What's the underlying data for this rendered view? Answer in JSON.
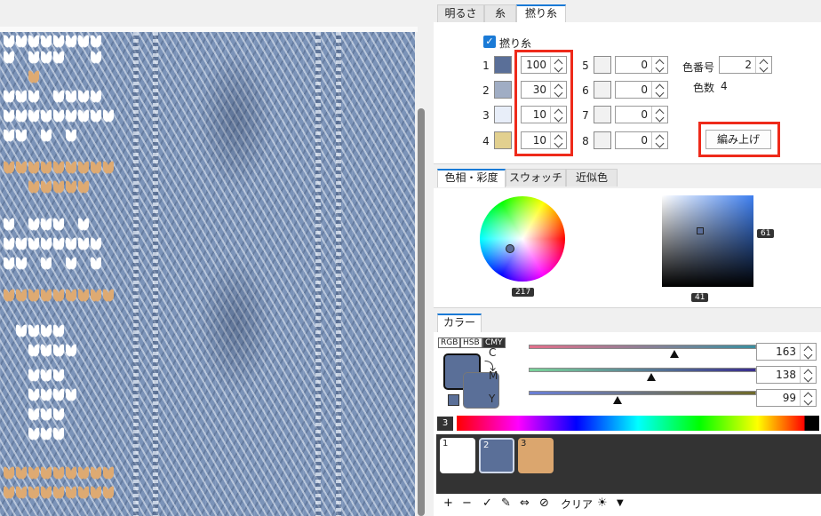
{
  "tabs_top": [
    {
      "label": "明るさ"
    },
    {
      "label": "糸"
    },
    {
      "label": "撚り糸"
    }
  ],
  "yarn": {
    "checkbox_label": "撚り糸",
    "rows_left": [
      {
        "num": "1",
        "color": "#5a6f98",
        "value": "100"
      },
      {
        "num": "2",
        "color": "#a0adc4",
        "value": "30"
      },
      {
        "num": "3",
        "color": "#e8eef9",
        "value": "10"
      },
      {
        "num": "4",
        "color": "#e2d08f",
        "value": "10"
      }
    ],
    "rows_right": [
      {
        "num": "5",
        "color": "#f1f1f1",
        "value": "0"
      },
      {
        "num": "6",
        "color": "#f1f1f1",
        "value": "0"
      },
      {
        "num": "7",
        "color": "#f1f1f1",
        "value": "0"
      },
      {
        "num": "8",
        "color": "#f1f1f1",
        "value": "0"
      }
    ],
    "color_number_label": "色番号",
    "color_number_value": "2",
    "color_count_label": "色数",
    "color_count_value": "4",
    "knit_button": "編み上げ"
  },
  "tabs_mid": [
    {
      "label": "色相・彩度"
    },
    {
      "label": "スウォッチ"
    },
    {
      "label": "近似色"
    }
  ],
  "picker": {
    "hue_value": "217",
    "saturation_value": "61",
    "brightness_value": "41"
  },
  "color_tab": {
    "label": "カラー"
  },
  "modes": [
    {
      "label": "RGB"
    },
    {
      "label": "HSB"
    },
    {
      "label": "CMY"
    }
  ],
  "current_color": "#5a6f98",
  "sliders": [
    {
      "label": "C",
      "value": "163",
      "fraction": 0.64,
      "gradient": "linear-gradient(to right,#e36f8b,#3a8fa0)"
    },
    {
      "label": "M",
      "value": "138",
      "fraction": 0.54,
      "gradient": "linear-gradient(to right,#7ad39a,#3a2e8f)"
    },
    {
      "label": "Y",
      "value": "99",
      "fraction": 0.39,
      "gradient": "linear-gradient(to right,#6a7fd8,#6f6a2a)"
    }
  ],
  "palette_index": "3",
  "chips": [
    {
      "num": "1",
      "color": "#ffffff"
    },
    {
      "num": "2",
      "color": "#5a6f98"
    },
    {
      "num": "3",
      "color": "#dba66e"
    }
  ],
  "toolbar": {
    "add": "+",
    "remove": "−",
    "check": "✓",
    "pen": "✎",
    "swap": "⇔",
    "forbid": "⊘",
    "clear": "クリア",
    "sun": "☀",
    "menu": "▼"
  }
}
